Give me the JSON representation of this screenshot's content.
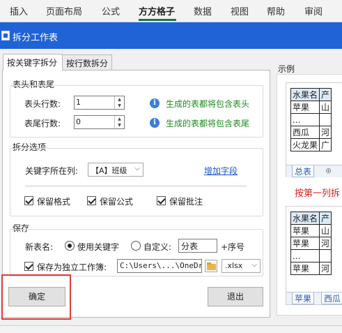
{
  "ribbon": {
    "tabs": [
      "插入",
      "页面布局",
      "公式",
      "方方格子",
      "数据",
      "视图",
      "帮助",
      "审阅"
    ],
    "active_tab": "方方格子",
    "accent_color": "#217346"
  },
  "dialog": {
    "title": "拆分工作表",
    "title_bar_color": "#1f63d6",
    "tabs": [
      "按关键字拆分",
      "按行数拆分"
    ],
    "active_tab": "按关键字拆分"
  },
  "header_footer": {
    "group_title": "表头和表尾",
    "header_rows_label": "表头行数:",
    "header_rows_value": "1",
    "header_hint": "生成的表都将包含表头",
    "footer_rows_label": "表尾行数:",
    "footer_rows_value": "0",
    "footer_hint": "生成的表都将包含表尾",
    "hint_color": "#1e8a1e"
  },
  "split_options": {
    "group_title": "拆分选项",
    "keyword_column_label": "关键字所在列:",
    "keyword_column_value": "【A】班级",
    "add_field_link": "增加字段",
    "keep_format_label": "保留格式",
    "keep_format_checked": true,
    "keep_formula_label": "保留公式",
    "keep_formula_checked": true,
    "keep_comment_label": "保留批注",
    "keep_comment_checked": true
  },
  "save": {
    "group_title": "保存",
    "new_name_label": "新表名:",
    "use_keyword_label": "使用关键字",
    "use_keyword_selected": true,
    "custom_label": "自定义:",
    "custom_selected": false,
    "custom_value": "分表",
    "suffix_label": "+序号",
    "save_as_workbook_label": "保存为独立工作簿:",
    "save_as_workbook_checked": true,
    "path_value": "C:\\Users\\...\\OneDri",
    "extension_value": ".xlsx"
  },
  "buttons": {
    "ok": "确定",
    "cancel": "退出"
  },
  "example": {
    "label": "示例",
    "thumb1": {
      "rows": [
        [
          "水果名",
          "产"
        ],
        [
          "苹果",
          "山"
        ],
        [
          "...",
          ""
        ],
        [
          "西瓜",
          "河"
        ],
        [
          "火龙果",
          "广"
        ]
      ],
      "sheet_tab": "总表"
    },
    "note": "按第一列拆",
    "thumb2": {
      "rows": [
        [
          "水果名",
          "产"
        ],
        [
          "苹果",
          "山"
        ],
        [
          "苹果",
          "河"
        ],
        [
          "...",
          ""
        ],
        [
          "苹果",
          "河"
        ]
      ],
      "sheet_tabs": [
        "苹果",
        "西瓜"
      ]
    }
  }
}
